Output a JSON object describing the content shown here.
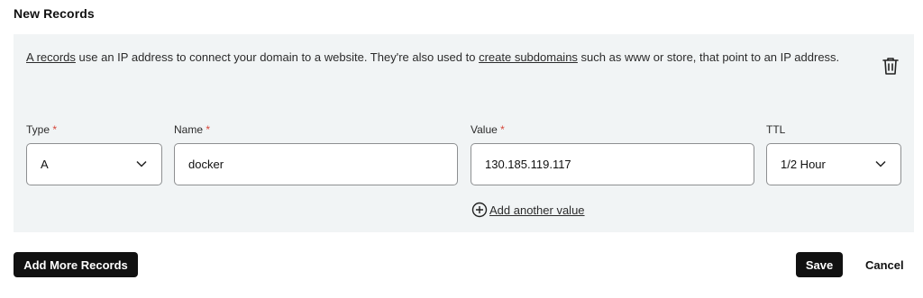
{
  "section_title": "New Records",
  "description": {
    "link1": "A records",
    "text1": " use an IP address to connect your domain to a website. They're also used to ",
    "link2": "create subdomains",
    "text2": " such as www or store, that point to an IP address."
  },
  "fields": {
    "type": {
      "label": "Type",
      "required_mark": "*",
      "value": "A"
    },
    "name": {
      "label": "Name",
      "required_mark": "*",
      "value": "docker"
    },
    "value": {
      "label": "Value",
      "required_mark": "*",
      "value": "130.185.119.117"
    },
    "ttl": {
      "label": "TTL",
      "value": "1/2 Hour"
    }
  },
  "add_value_label": "Add another value",
  "buttons": {
    "add_more": "Add More Records",
    "save": "Save",
    "cancel": "Cancel"
  },
  "icons": {
    "delete": "trash-icon",
    "dropdown": "chevron-down-icon",
    "add": "plus-circle-icon"
  }
}
